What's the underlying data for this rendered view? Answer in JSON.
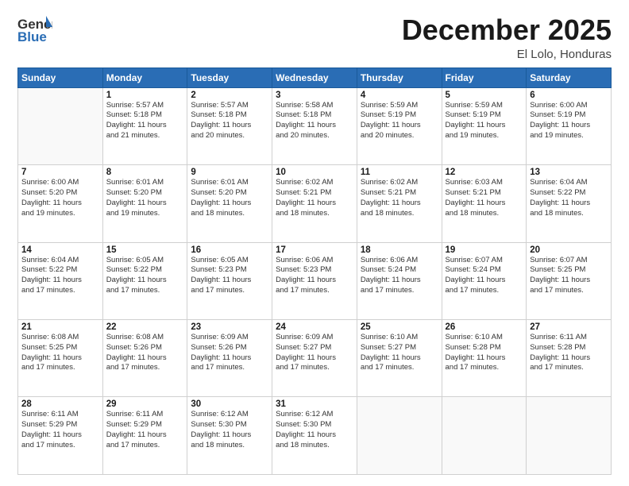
{
  "header": {
    "logo_general": "General",
    "logo_blue": "Blue",
    "month": "December 2025",
    "location": "El Lolo, Honduras"
  },
  "weekdays": [
    "Sunday",
    "Monday",
    "Tuesday",
    "Wednesday",
    "Thursday",
    "Friday",
    "Saturday"
  ],
  "weeks": [
    [
      {
        "day": "",
        "info": ""
      },
      {
        "day": "1",
        "info": "Sunrise: 5:57 AM\nSunset: 5:18 PM\nDaylight: 11 hours\nand 21 minutes."
      },
      {
        "day": "2",
        "info": "Sunrise: 5:57 AM\nSunset: 5:18 PM\nDaylight: 11 hours\nand 20 minutes."
      },
      {
        "day": "3",
        "info": "Sunrise: 5:58 AM\nSunset: 5:18 PM\nDaylight: 11 hours\nand 20 minutes."
      },
      {
        "day": "4",
        "info": "Sunrise: 5:59 AM\nSunset: 5:19 PM\nDaylight: 11 hours\nand 20 minutes."
      },
      {
        "day": "5",
        "info": "Sunrise: 5:59 AM\nSunset: 5:19 PM\nDaylight: 11 hours\nand 19 minutes."
      },
      {
        "day": "6",
        "info": "Sunrise: 6:00 AM\nSunset: 5:19 PM\nDaylight: 11 hours\nand 19 minutes."
      }
    ],
    [
      {
        "day": "7",
        "info": "Sunrise: 6:00 AM\nSunset: 5:20 PM\nDaylight: 11 hours\nand 19 minutes."
      },
      {
        "day": "8",
        "info": "Sunrise: 6:01 AM\nSunset: 5:20 PM\nDaylight: 11 hours\nand 19 minutes."
      },
      {
        "day": "9",
        "info": "Sunrise: 6:01 AM\nSunset: 5:20 PM\nDaylight: 11 hours\nand 18 minutes."
      },
      {
        "day": "10",
        "info": "Sunrise: 6:02 AM\nSunset: 5:21 PM\nDaylight: 11 hours\nand 18 minutes."
      },
      {
        "day": "11",
        "info": "Sunrise: 6:02 AM\nSunset: 5:21 PM\nDaylight: 11 hours\nand 18 minutes."
      },
      {
        "day": "12",
        "info": "Sunrise: 6:03 AM\nSunset: 5:21 PM\nDaylight: 11 hours\nand 18 minutes."
      },
      {
        "day": "13",
        "info": "Sunrise: 6:04 AM\nSunset: 5:22 PM\nDaylight: 11 hours\nand 18 minutes."
      }
    ],
    [
      {
        "day": "14",
        "info": "Sunrise: 6:04 AM\nSunset: 5:22 PM\nDaylight: 11 hours\nand 17 minutes."
      },
      {
        "day": "15",
        "info": "Sunrise: 6:05 AM\nSunset: 5:22 PM\nDaylight: 11 hours\nand 17 minutes."
      },
      {
        "day": "16",
        "info": "Sunrise: 6:05 AM\nSunset: 5:23 PM\nDaylight: 11 hours\nand 17 minutes."
      },
      {
        "day": "17",
        "info": "Sunrise: 6:06 AM\nSunset: 5:23 PM\nDaylight: 11 hours\nand 17 minutes."
      },
      {
        "day": "18",
        "info": "Sunrise: 6:06 AM\nSunset: 5:24 PM\nDaylight: 11 hours\nand 17 minutes."
      },
      {
        "day": "19",
        "info": "Sunrise: 6:07 AM\nSunset: 5:24 PM\nDaylight: 11 hours\nand 17 minutes."
      },
      {
        "day": "20",
        "info": "Sunrise: 6:07 AM\nSunset: 5:25 PM\nDaylight: 11 hours\nand 17 minutes."
      }
    ],
    [
      {
        "day": "21",
        "info": "Sunrise: 6:08 AM\nSunset: 5:25 PM\nDaylight: 11 hours\nand 17 minutes."
      },
      {
        "day": "22",
        "info": "Sunrise: 6:08 AM\nSunset: 5:26 PM\nDaylight: 11 hours\nand 17 minutes."
      },
      {
        "day": "23",
        "info": "Sunrise: 6:09 AM\nSunset: 5:26 PM\nDaylight: 11 hours\nand 17 minutes."
      },
      {
        "day": "24",
        "info": "Sunrise: 6:09 AM\nSunset: 5:27 PM\nDaylight: 11 hours\nand 17 minutes."
      },
      {
        "day": "25",
        "info": "Sunrise: 6:10 AM\nSunset: 5:27 PM\nDaylight: 11 hours\nand 17 minutes."
      },
      {
        "day": "26",
        "info": "Sunrise: 6:10 AM\nSunset: 5:28 PM\nDaylight: 11 hours\nand 17 minutes."
      },
      {
        "day": "27",
        "info": "Sunrise: 6:11 AM\nSunset: 5:28 PM\nDaylight: 11 hours\nand 17 minutes."
      }
    ],
    [
      {
        "day": "28",
        "info": "Sunrise: 6:11 AM\nSunset: 5:29 PM\nDaylight: 11 hours\nand 17 minutes."
      },
      {
        "day": "29",
        "info": "Sunrise: 6:11 AM\nSunset: 5:29 PM\nDaylight: 11 hours\nand 17 minutes."
      },
      {
        "day": "30",
        "info": "Sunrise: 6:12 AM\nSunset: 5:30 PM\nDaylight: 11 hours\nand 18 minutes."
      },
      {
        "day": "31",
        "info": "Sunrise: 6:12 AM\nSunset: 5:30 PM\nDaylight: 11 hours\nand 18 minutes."
      },
      {
        "day": "",
        "info": ""
      },
      {
        "day": "",
        "info": ""
      },
      {
        "day": "",
        "info": ""
      }
    ]
  ]
}
